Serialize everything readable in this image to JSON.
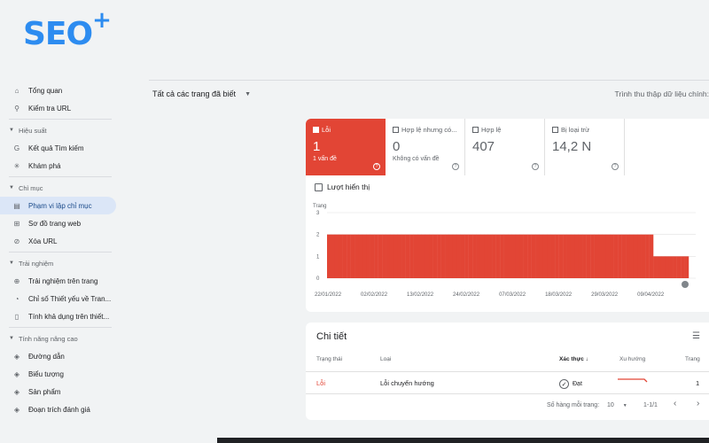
{
  "logo": {
    "text": "SEO",
    "plus": "+"
  },
  "sidebar": {
    "items": [
      {
        "label": "Tổng quan",
        "icon": "home-icon"
      },
      {
        "label": "Kiểm tra URL",
        "icon": "search-icon"
      },
      {
        "section": "Hiệu suất"
      },
      {
        "label": "Kết quả Tìm kiếm",
        "icon": "google-icon"
      },
      {
        "label": "Khám phá",
        "icon": "asterisk-icon"
      },
      {
        "section": "Chỉ mục"
      },
      {
        "label": "Phạm vi lập chỉ mục",
        "icon": "document-icon",
        "active": true
      },
      {
        "label": "Sơ đồ trang web",
        "icon": "sitemap-icon"
      },
      {
        "label": "Xóa URL",
        "icon": "eye-off-icon"
      },
      {
        "section": "Trải nghiệm"
      },
      {
        "label": "Trải nghiệm trên trang",
        "icon": "plus-circle-icon"
      },
      {
        "label": "Chỉ số Thiết yếu về Tran...",
        "icon": "gauge-icon"
      },
      {
        "label": "Tính khả dụng trên thiết...",
        "icon": "phone-icon"
      },
      {
        "section": "Tính năng nâng cao"
      },
      {
        "label": "Đường dẫn",
        "icon": "layers-icon"
      },
      {
        "label": "Biểu tượng",
        "icon": "layers-icon"
      },
      {
        "label": "Sản phẩm",
        "icon": "layers-icon"
      },
      {
        "label": "Đoạn trích đánh giá",
        "icon": "layers-icon"
      }
    ]
  },
  "topbar": {
    "filter": "Tất cả các trang đã biết",
    "crawler": "Trình thu thập dữ liệu chính: "
  },
  "tiles": {
    "error": {
      "label": "Lỗi",
      "value": "1",
      "sub": "1 vấn đề"
    },
    "warn": {
      "label": "Hợp lệ nhưng có...",
      "value": "0",
      "sub": "Không có vấn đề"
    },
    "valid": {
      "label": "Hợp lệ",
      "value": "407"
    },
    "excluded": {
      "label": "Bị loại trừ",
      "value": "14,2 N"
    }
  },
  "impressions": "Lượt hiển thị",
  "chart_data": {
    "type": "bar",
    "ylabel": "Trang",
    "ylim": [
      0,
      3
    ],
    "yticks": [
      "3",
      "2",
      "1",
      "0"
    ],
    "xticks": [
      "22/01/2022",
      "02/02/2022",
      "13/02/2022",
      "24/02/2022",
      "07/03/2022",
      "18/03/2022",
      "29/03/2022",
      "09/04/2022"
    ],
    "color": "#e24535",
    "n_bars": 92,
    "values_summary": {
      "first_83": 2,
      "last_9": 1
    }
  },
  "detail": {
    "title": "Chi tiết",
    "headers": {
      "status": "Trạng thái",
      "type": "Loại",
      "validation": "Xác thực",
      "trend": "Xu hướng",
      "pages": "Trang"
    },
    "row": {
      "status": "Lỗi",
      "type": "Lỗi chuyển hướng",
      "validation": "Đạt",
      "pages": "1"
    },
    "pager": {
      "rows_label": "Số hàng mỗi trang:",
      "rows_value": "10",
      "range": "1-1/1"
    }
  },
  "colors": {
    "error": "#e24535",
    "accent": "#1a73e8"
  }
}
